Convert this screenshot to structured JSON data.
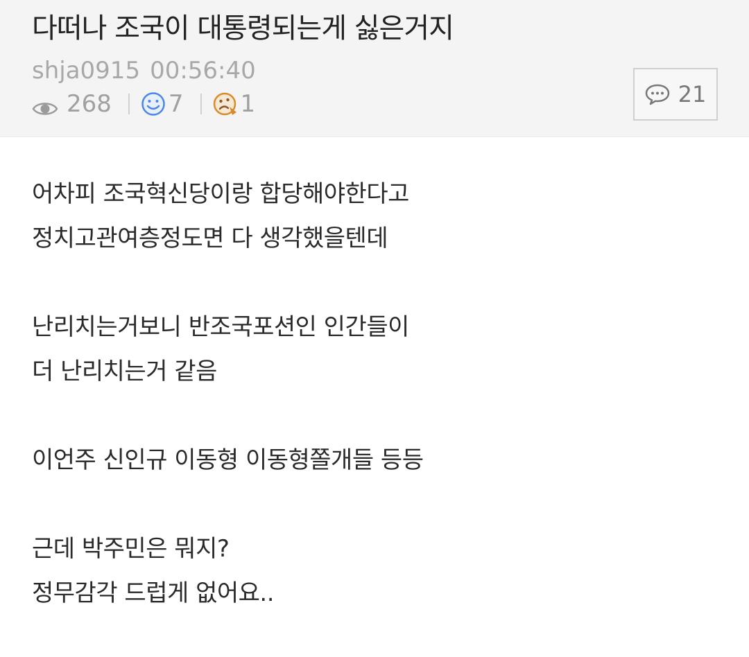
{
  "post": {
    "title": "다떠나 조국이 대통령되는게 싫은거지",
    "author": "shja0915",
    "time": "00:56:40",
    "views": "268",
    "likes": "7",
    "dislikes": "1",
    "comments": "21"
  },
  "icons": {
    "views": "eye-icon",
    "likes": "smile-face-icon",
    "dislikes": "frown-face-icon",
    "comments": "speech-bubble-icon"
  },
  "colors": {
    "header_bg": "#f4f4f4",
    "like_blue": "#4a86e8",
    "dislike_orange": "#d98b2b"
  },
  "body": {
    "paragraphs": [
      [
        "어차피 조국혁신당이랑 합당해야한다고",
        "정치고관여층정도면 다 생각했을텐데"
      ],
      [
        "난리치는거보니 반조국포션인 인간들이",
        "더 난리치는거 같음"
      ],
      [
        "이언주 신인규 이동형 이동형쫄개들 등등"
      ],
      [
        "근데 박주민은 뭐지?",
        "정무감각 드럽게 없어요.."
      ]
    ]
  }
}
